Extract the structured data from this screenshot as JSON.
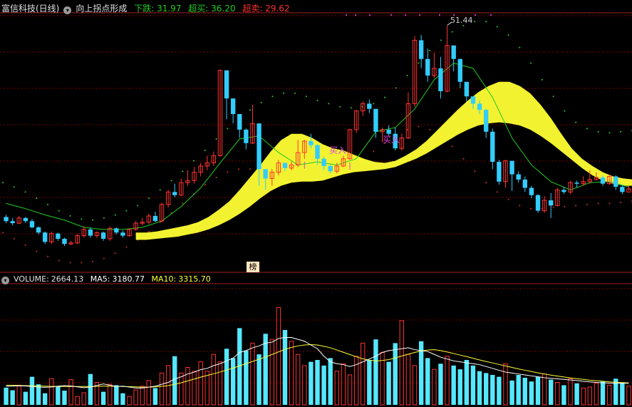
{
  "header": {
    "stock_name": "富信科技(日线)",
    "indicator_name": "向上拐点形成",
    "items": [
      {
        "label": "下跌:",
        "value": "31.97",
        "color": "#22cc22"
      },
      {
        "label": "超买:",
        "value": "36.20",
        "color": "#22cc22"
      },
      {
        "label": "超卖:",
        "value": "29.62",
        "color": "#ff3030"
      }
    ]
  },
  "volume_header": {
    "volume_label": "VOLUME:",
    "volume_value": "2664.13",
    "ma5_label": "MA5:",
    "ma5_value": "3180.77",
    "ma10_label": "MA10:",
    "ma10_value": "3315.70"
  },
  "annotations": {
    "buy_label": "买入",
    "peak_value": "51.44",
    "badge": "榜"
  },
  "colors": {
    "up": "#ff3333",
    "down": "#33ccff",
    "ribbon": "#ffff33",
    "upper_band": "#33cc33",
    "lower_band": "#cc3333",
    "ma5": "#ffffff",
    "ma10": "#ffff33",
    "grid": "#800000"
  },
  "chart_data": [
    {
      "type": "candlestick",
      "title": "富信科技(日线) 向上拐点形成",
      "ylim": [
        28.5,
        52.5
      ],
      "candles": [
        [
          33.0,
          32.6,
          33.2,
          32.4
        ],
        [
          32.6,
          32.4,
          32.9,
          32.2
        ],
        [
          32.4,
          32.9,
          33.1,
          32.3
        ],
        [
          32.9,
          32.6,
          33.0,
          32.4
        ],
        [
          32.6,
          32.0,
          32.8,
          31.9
        ],
        [
          32.0,
          31.5,
          32.1,
          31.3
        ],
        [
          31.5,
          30.6,
          31.6,
          30.4
        ],
        [
          30.6,
          31.4,
          31.6,
          30.4
        ],
        [
          31.4,
          30.9,
          31.5,
          30.7
        ],
        [
          30.9,
          30.4,
          31.0,
          30.2
        ],
        [
          30.4,
          30.5,
          30.7,
          30.3
        ],
        [
          30.5,
          31.2,
          31.4,
          30.4
        ],
        [
          31.2,
          31.8,
          32.1,
          31.0
        ],
        [
          31.8,
          31.2,
          32.0,
          31.0
        ],
        [
          31.2,
          31.5,
          31.6,
          31.0
        ],
        [
          31.5,
          30.9,
          31.6,
          30.7
        ],
        [
          30.9,
          31.9,
          32.1,
          30.7
        ],
        [
          31.9,
          31.5,
          32.0,
          31.3
        ],
        [
          31.5,
          31.2,
          31.7,
          31.0
        ],
        [
          31.2,
          31.8,
          31.9,
          31.1
        ],
        [
          31.8,
          32.4,
          32.6,
          31.7
        ],
        [
          32.4,
          32.5,
          32.9,
          32.2
        ],
        [
          32.5,
          33.1,
          33.3,
          32.3
        ],
        [
          33.1,
          32.6,
          33.5,
          32.5
        ],
        [
          32.6,
          34.2,
          34.4,
          32.5
        ],
        [
          34.2,
          35.4,
          35.6,
          33.9
        ],
        [
          35.4,
          35.1,
          36.2,
          34.9
        ],
        [
          35.1,
          36.3,
          36.7,
          35.0
        ],
        [
          36.3,
          36.5,
          37.5,
          36.0
        ],
        [
          36.5,
          37.3,
          37.8,
          36.2
        ],
        [
          37.3,
          37.9,
          38.2,
          36.9
        ],
        [
          37.9,
          38.2,
          38.9,
          37.5
        ],
        [
          38.2,
          38.9,
          39.3,
          37.9
        ],
        [
          38.9,
          47.1,
          47.2,
          38.8
        ],
        [
          47.1,
          44.4,
          47.1,
          42.4
        ],
        [
          44.4,
          42.9,
          43.9,
          42.0
        ],
        [
          42.9,
          41.4,
          42.5,
          40.6
        ],
        [
          41.4,
          40.1,
          41.5,
          39.5
        ],
        [
          40.1,
          42.0,
          43.8,
          40.0
        ],
        [
          42.0,
          37.6,
          41.6,
          36.0
        ],
        [
          37.6,
          36.7,
          37.4,
          35.6
        ],
        [
          36.7,
          37.3,
          37.6,
          36.0
        ],
        [
          37.3,
          38.2,
          38.5,
          37.0
        ],
        [
          38.2,
          37.7,
          38.2,
          37.4
        ],
        [
          37.7,
          38.0,
          38.3,
          37.5
        ],
        [
          38.0,
          39.2,
          40.4,
          37.8
        ],
        [
          39.2,
          40.3,
          40.4,
          38.6
        ],
        [
          40.3,
          39.9,
          41.0,
          39.6
        ],
        [
          39.9,
          38.6,
          40.0,
          38.0
        ],
        [
          38.6,
          37.9,
          38.8,
          37.5
        ],
        [
          37.9,
          37.4,
          38.1,
          37.2
        ],
        [
          37.4,
          37.9,
          38.2,
          37.2
        ],
        [
          37.9,
          38.6,
          38.9,
          37.8
        ],
        [
          38.6,
          41.4,
          41.5,
          38.5
        ],
        [
          41.4,
          43.2,
          43.3,
          41.1
        ],
        [
          43.2,
          43.9,
          44.1,
          42.7
        ],
        [
          43.9,
          43.4,
          44.3,
          43.0
        ],
        [
          43.4,
          41.2,
          41.9,
          40.6
        ],
        [
          41.2,
          41.4,
          41.6,
          40.2
        ],
        [
          41.4,
          41.0,
          41.8,
          40.8
        ],
        [
          41.0,
          39.6,
          41.6,
          39.4
        ],
        [
          39.6,
          40.6,
          41.0,
          39.4
        ],
        [
          40.6,
          43.9,
          45.0,
          40.5
        ],
        [
          43.9,
          50.0,
          50.4,
          43.6
        ],
        [
          50.0,
          48.2,
          50.5,
          47.3
        ],
        [
          48.2,
          46.6,
          49.2,
          46.0
        ],
        [
          46.6,
          47.3,
          48.8,
          46.4
        ],
        [
          47.3,
          45.1,
          48.4,
          44.4
        ],
        [
          45.1,
          49.5,
          51.4,
          45.0
        ],
        [
          49.5,
          48.2,
          49.4,
          47.0
        ],
        [
          48.2,
          46.0,
          47.5,
          45.4
        ],
        [
          46.0,
          44.6,
          44.9,
          44.1
        ],
        [
          44.6,
          43.9,
          44.2,
          43.4
        ],
        [
          43.9,
          43.3,
          44.2,
          42.9
        ],
        [
          43.3,
          41.2,
          43.4,
          40.6
        ],
        [
          41.2,
          38.3,
          41.5,
          37.6
        ],
        [
          38.3,
          36.4,
          38.5,
          36.1
        ],
        [
          36.4,
          38.4,
          38.5,
          35.8
        ],
        [
          38.4,
          37.1,
          37.9,
          35.5
        ],
        [
          37.1,
          36.6,
          37.4,
          36.3
        ],
        [
          36.6,
          35.8,
          36.9,
          35.4
        ],
        [
          35.8,
          35.1,
          36.0,
          34.8
        ],
        [
          35.1,
          33.6,
          35.2,
          33.4
        ],
        [
          33.6,
          34.6,
          35.0,
          33.4
        ],
        [
          34.6,
          34.1,
          35.3,
          32.9
        ],
        [
          34.1,
          35.6,
          35.8,
          34.0
        ],
        [
          35.6,
          35.4,
          35.9,
          35.2
        ],
        [
          35.4,
          36.3,
          36.5,
          35.2
        ],
        [
          36.3,
          36.2,
          36.5,
          35.8
        ],
        [
          36.2,
          36.4,
          36.9,
          36.0
        ],
        [
          36.4,
          36.6,
          37.5,
          36.2
        ],
        [
          36.6,
          36.8,
          37.3,
          36.5
        ],
        [
          36.8,
          36.2,
          37.0,
          36.0
        ],
        [
          36.2,
          36.9,
          37.1,
          36.1
        ],
        [
          36.9,
          35.9,
          37.0,
          35.6
        ],
        [
          35.9,
          35.4,
          36.1,
          35.2
        ],
        [
          35.4,
          35.7,
          36.0,
          35.5
        ]
      ],
      "ribbon": [
        [
          30.8,
          31.5
        ],
        [
          30.8,
          31.5
        ],
        [
          30.9,
          31.6
        ],
        [
          31.0,
          31.8
        ],
        [
          31.1,
          32.0
        ],
        [
          31.3,
          32.2
        ],
        [
          31.5,
          32.5
        ],
        [
          31.8,
          33.0
        ],
        [
          32.2,
          33.7
        ],
        [
          32.7,
          34.5
        ],
        [
          33.3,
          35.6
        ],
        [
          34.0,
          36.8
        ],
        [
          34.8,
          38.0
        ],
        [
          35.5,
          39.3
        ],
        [
          36.0,
          40.4
        ],
        [
          36.3,
          41.0
        ],
        [
          36.4,
          41.0
        ],
        [
          36.4,
          40.6
        ],
        [
          36.5,
          40.0
        ],
        [
          36.8,
          39.6
        ],
        [
          37.1,
          39.4
        ],
        [
          37.3,
          39.0
        ],
        [
          37.4,
          38.6
        ],
        [
          37.5,
          38.3
        ],
        [
          37.6,
          38.2
        ],
        [
          37.8,
          38.4
        ],
        [
          38.2,
          38.9
        ],
        [
          38.6,
          39.5
        ],
        [
          39.1,
          40.3
        ],
        [
          39.7,
          41.3
        ],
        [
          40.3,
          42.3
        ],
        [
          40.9,
          43.3
        ],
        [
          41.4,
          44.2
        ],
        [
          41.8,
          45.0
        ],
        [
          42.0,
          45.6
        ],
        [
          42.1,
          46.0
        ],
        [
          42.0,
          46.0
        ],
        [
          41.8,
          45.6
        ],
        [
          41.4,
          44.9
        ],
        [
          40.8,
          43.8
        ],
        [
          40.1,
          42.5
        ],
        [
          39.3,
          41.0
        ],
        [
          38.5,
          39.6
        ],
        [
          37.7,
          38.6
        ],
        [
          37.0,
          37.9
        ],
        [
          36.5,
          37.3
        ],
        [
          36.2,
          36.9
        ],
        [
          36.0,
          36.7
        ],
        [
          36.0,
          36.6
        ],
        [
          36.1,
          36.6
        ]
      ],
      "ribbon_start_index": 20,
      "ribbon_index_step": 1.6,
      "upper_band": [
        36.3,
        35.9,
        35.4,
        34.8,
        34.2,
        33.6,
        33.1,
        32.8,
        32.7,
        32.9,
        33.2,
        33.6,
        34.1,
        34.8,
        35.6,
        36.5,
        37.4,
        38.4,
        39.4,
        40.5,
        41.5,
        42.5,
        43.3,
        44.0,
        44.6,
        44.9,
        44.9,
        44.6,
        44.2,
        43.9,
        43.6,
        43.5,
        43.6,
        43.9,
        44.5,
        45.4,
        46.6,
        47.8,
        49.0,
        50.0,
        50.8,
        51.4,
        51.8,
        51.8,
        51.3,
        50.5,
        49.3,
        47.8,
        46.2,
        44.6,
        43.2,
        42.1,
        41.5,
        41.2,
        41.1,
        41.2,
        41.3
      ],
      "lower_band": [
        31.5,
        30.9,
        30.3,
        29.7,
        29.2,
        28.8,
        28.6,
        28.6,
        28.7,
        29.0,
        29.5,
        30.1,
        30.8,
        31.6,
        32.5,
        33.4,
        34.3,
        35.2,
        36.1,
        36.8,
        37.3,
        37.6,
        37.6,
        37.4,
        37.0,
        36.7,
        36.5,
        36.5,
        36.6,
        36.9,
        37.3,
        37.8,
        38.5,
        39.3,
        40.1,
        40.8,
        41.4,
        41.7,
        41.4,
        40.7,
        39.8,
        38.6,
        37.4,
        36.3,
        35.4,
        34.7,
        34.1,
        33.8,
        33.8,
        33.9,
        34.0,
        34.1,
        34.2,
        34.3,
        34.3,
        34.4,
        34.5
      ],
      "green_line": [
        [
          0,
          34.3
        ],
        [
          3,
          33.8
        ],
        [
          6,
          33.2
        ],
        [
          9,
          32.7
        ],
        [
          12,
          32.0
        ],
        [
          15,
          31.8
        ],
        [
          18,
          31.8
        ],
        [
          21,
          32.0
        ],
        [
          24,
          32.6
        ],
        [
          27,
          34.0
        ],
        [
          30,
          35.8
        ],
        [
          33,
          38.2
        ],
        [
          36,
          40.5
        ],
        [
          39,
          40.8
        ],
        [
          42,
          39.2
        ],
        [
          45,
          38.0
        ],
        [
          48,
          38.3
        ],
        [
          51,
          38.0
        ],
        [
          54,
          38.6
        ],
        [
          57,
          41.2
        ],
        [
          60,
          41.6
        ],
        [
          63,
          43.4
        ],
        [
          66,
          46.2
        ],
        [
          69,
          47.8
        ],
        [
          72,
          47.3
        ],
        [
          75,
          44.5
        ],
        [
          78,
          40.6
        ],
        [
          81,
          38.0
        ],
        [
          84,
          36.4
        ],
        [
          87,
          35.6
        ],
        [
          90,
          36.3
        ],
        [
          93,
          36.4
        ],
        [
          96,
          35.9
        ]
      ],
      "buy_markers": [
        {
          "index": 46,
          "label": "买入"
        },
        {
          "index": 53,
          "label": "买入"
        }
      ],
      "peak_annotation": {
        "index": 68,
        "value": 51.44
      }
    },
    {
      "type": "bar",
      "title": "VOLUME",
      "series_names": [
        "VOLUME",
        "MA5",
        "MA10"
      ],
      "ylim": [
        0,
        6400
      ],
      "volumes": [
        920,
        780,
        1050,
        700,
        1500,
        1100,
        620,
        1400,
        980,
        760,
        1350,
        450,
        650,
        1650,
        1200,
        700,
        1100,
        1050,
        620,
        450,
        800,
        1000,
        1300,
        900,
        1700,
        2100,
        2600,
        1700,
        2000,
        1800,
        2300,
        1800,
        2700,
        2300,
        3000,
        2500,
        4100,
        2900,
        3300,
        2700,
        3800,
        3500,
        5200,
        4000,
        3400,
        2700,
        2100,
        2300,
        2400,
        2100,
        2500,
        1800,
        2200,
        1600,
        2600,
        3300,
        2400,
        3500,
        2800,
        2300,
        3300,
        4500,
        2700,
        2100,
        3400,
        2500,
        1900,
        2200,
        2600,
        2100,
        1900,
        2400,
        2100,
        1800,
        1700,
        1600,
        1500,
        2200,
        1300,
        1600,
        1450,
        1250,
        1500,
        1650,
        1350,
        1200,
        1050,
        1400,
        1150,
        900,
        950,
        1150,
        1250,
        1050,
        1400,
        1200,
        1000
      ],
      "ma5": [
        990,
        1000,
        1020,
        1010,
        980,
        950,
        940,
        950,
        1000,
        1030,
        1010,
        960,
        920,
        950,
        1040,
        1120,
        1050,
        980,
        1000,
        950,
        900,
        900,
        950,
        1000,
        1100,
        1200,
        1380,
        1500,
        1650,
        1750,
        1880,
        1950,
        2100,
        2200,
        2350,
        2500,
        2800,
        2900,
        3050,
        3150,
        3300,
        3350,
        3550,
        3600,
        3600,
        3500,
        3400,
        3200,
        3000,
        2600,
        2300,
        2200,
        2150,
        2050,
        2150,
        2300,
        2450,
        2600,
        2800,
        2900,
        2950,
        3000,
        3050,
        2950,
        2900,
        2850,
        2700,
        2550,
        2450,
        2350,
        2300,
        2250,
        2200,
        2150,
        2050,
        1950,
        1850,
        1750,
        1700,
        1650,
        1600,
        1550,
        1500,
        1450,
        1420,
        1390,
        1360,
        1330,
        1300,
        1260,
        1230,
        1200,
        1180,
        1160,
        1150,
        1160,
        1150
      ],
      "ma10": [
        1050,
        1050,
        1040,
        1030,
        1020,
        1010,
        1000,
        990,
        980,
        980,
        980,
        980,
        980,
        980,
        990,
        1000,
        1000,
        990,
        980,
        970,
        960,
        950,
        950,
        960,
        990,
        1030,
        1100,
        1180,
        1280,
        1380,
        1480,
        1570,
        1660,
        1760,
        1860,
        1970,
        2080,
        2200,
        2320,
        2440,
        2560,
        2690,
        2830,
        2970,
        3070,
        3150,
        3200,
        3220,
        3200,
        3130,
        3050,
        2930,
        2810,
        2690,
        2570,
        2460,
        2390,
        2350,
        2370,
        2420,
        2510,
        2610,
        2710,
        2800,
        2880,
        2930,
        2950,
        2900,
        2830,
        2740,
        2660,
        2580,
        2490,
        2400,
        2320,
        2240,
        2160,
        2080,
        2000,
        1920,
        1850,
        1780,
        1710,
        1650,
        1590,
        1540,
        1490,
        1440,
        1400,
        1360,
        1320,
        1290,
        1260,
        1230,
        1210,
        1190,
        1170
      ]
    }
  ]
}
